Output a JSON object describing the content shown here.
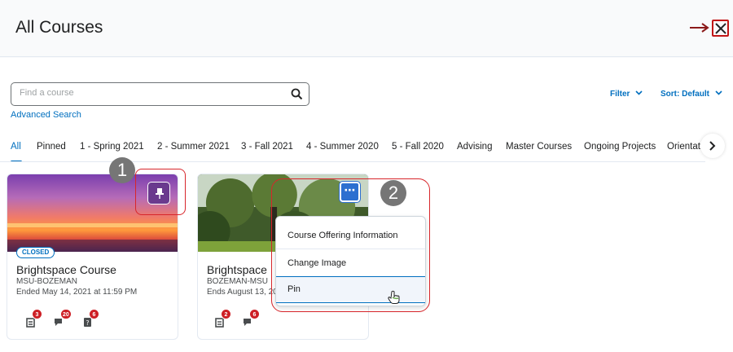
{
  "header": {
    "title": "All Courses",
    "close_icon": "close-icon",
    "arrow_icon": "arrow-right-icon"
  },
  "search": {
    "placeholder": "Find a course",
    "value": "",
    "icon": "search-icon"
  },
  "advanced_search": "Advanced Search",
  "filter_label": "Filter",
  "sort_label": "Sort: Default",
  "tabs": [
    {
      "label": "All",
      "active": true
    },
    {
      "label": "Pinned"
    },
    {
      "label": "1 - Spring 2021"
    },
    {
      "label": "2 - Summer 2021"
    },
    {
      "label": "3 - Fall 2021"
    },
    {
      "label": "4 - Summer 2020"
    },
    {
      "label": "5 - Fall 2020"
    },
    {
      "label": "Advising"
    },
    {
      "label": "Master Courses"
    },
    {
      "label": "Ongoing Projects"
    },
    {
      "label": "Orientat"
    }
  ],
  "cards": [
    {
      "title": "Brightspace Course",
      "org": "MSU-BOZEMAN",
      "ended": "Ended May 14, 2021 at 11:59 PM",
      "status": "CLOSED",
      "counts": [
        "3",
        "20",
        "6"
      ]
    },
    {
      "title": "Brightspace",
      "org": "BOZEMAN-MSU",
      "ended": "Ends August 13, 20",
      "counts": [
        "2",
        "6"
      ]
    }
  ],
  "callouts": [
    "1",
    "2"
  ],
  "more_label": "⋯",
  "menu": {
    "items": [
      "Course Offering Information",
      "Change Image",
      "Pin"
    ]
  },
  "colors": {
    "accent": "#006fbf",
    "pin_button": "#6a3a8e",
    "callout_red": "#d8262b",
    "badge_red": "#cd2026"
  }
}
